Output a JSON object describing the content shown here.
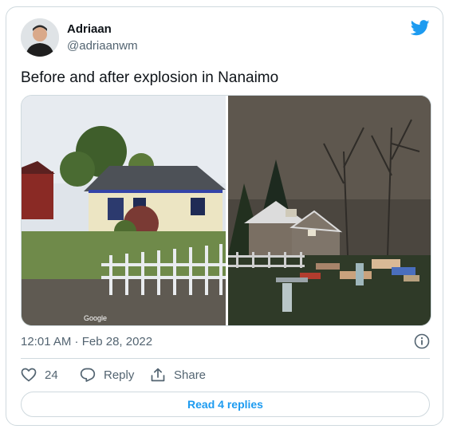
{
  "user": {
    "name": "Adriaan",
    "handle": "@adriaanwm"
  },
  "tweet": {
    "text": "Before and after explosion in Nanaimo"
  },
  "media": {
    "left_watermark": "Google"
  },
  "meta": {
    "time": "12:01 AM · Feb 28, 2022"
  },
  "actions": {
    "likes": "24",
    "reply_label": "Reply",
    "share_label": "Share"
  },
  "read_replies": "Read 4 replies",
  "colors": {
    "accent": "#1d9bf0",
    "text": "#0f1419",
    "muted": "#536471",
    "border": "#cfd9de"
  },
  "icons": [
    "twitter-bird-icon",
    "info-icon",
    "heart-icon",
    "reply-icon",
    "share-icon"
  ]
}
